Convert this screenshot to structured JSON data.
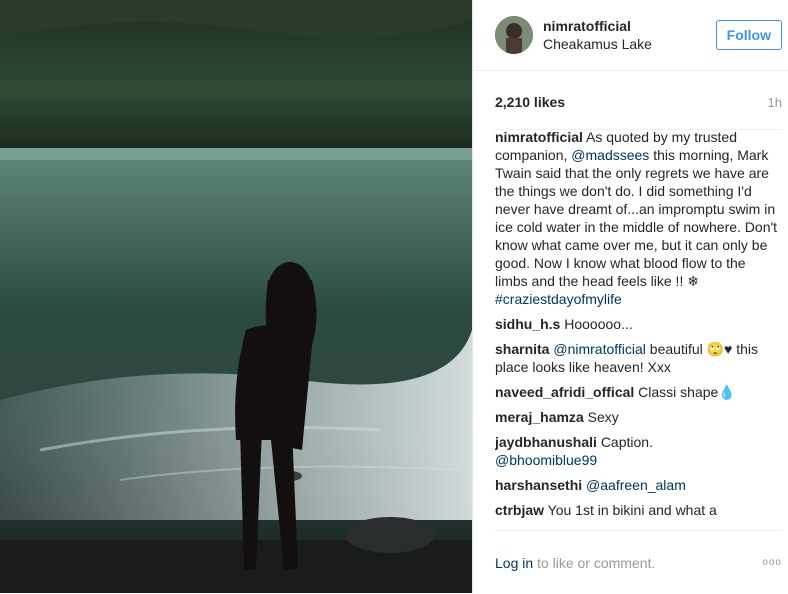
{
  "post": {
    "username": "nimratofficial",
    "location": "Cheakamus Lake",
    "follow_label": "Follow",
    "likes": "2,210 likes",
    "time": "1h"
  },
  "caption": {
    "username": "nimratofficial",
    "text_1": "As quoted by my trusted companion,",
    "mention": "@madssees",
    "text_2": "this morning, Mark Twain said that the only regrets we have are the things we don't do. I did something I'd never have dreamt of...an impromptu swim in ice cold water in the middle of nowhere. Don't know what came over me, but it can only be good. Now I know what blood flow to the limbs and the head feels like !! ❄",
    "hashtag": "#craziestdayofmylife"
  },
  "comments": [
    {
      "user": "sidhu_h.s",
      "mention": "",
      "text": "Hoooooo..."
    },
    {
      "user": "sharnita",
      "mention": "@nimratofficial",
      "text": "beautiful 🙄♥ this place looks like heaven! Xxx"
    },
    {
      "user": "naveed_afridi_offical",
      "mention": "",
      "text": "Classi shape💧"
    },
    {
      "user": "meraj_hamza",
      "mention": "",
      "text": "Sexy"
    },
    {
      "user": "jaydbhanushali",
      "mention": "",
      "text": "Caption."
    },
    {
      "user": "harshansethi",
      "mention": "@aafreen_alam",
      "text": ""
    },
    {
      "user": "ctrbjaw",
      "mention": "",
      "text": "You 1st in bikini and what a"
    }
  ],
  "jaydbhanushali_mention": "@bhoomiblue99",
  "footer": {
    "login": "Log in",
    "suffix": "to like or comment.",
    "more": "ooo"
  },
  "colors": {
    "link": "#003569",
    "follow_blue": "#3897f0",
    "muted": "#999999"
  },
  "icons": {
    "more": "more-options-icon"
  }
}
